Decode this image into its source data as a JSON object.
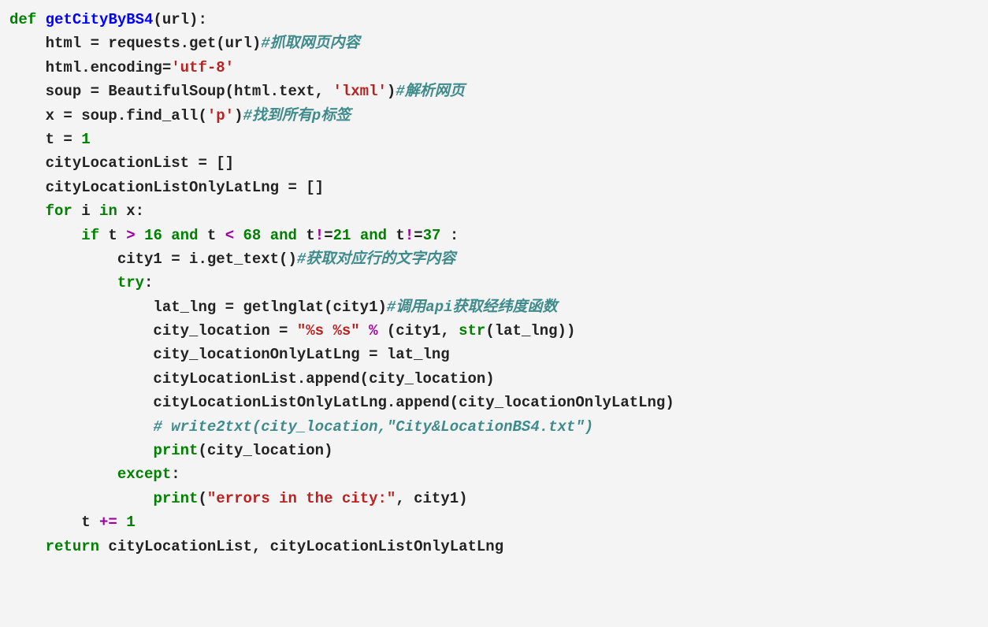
{
  "code": {
    "l1_def": "def",
    "l1_fn": "getCityByBS4",
    "l1_rest": "(url):",
    "l2_a": "    html = requests.get(url)",
    "l2_c": "#抓取网页内容",
    "l3_a": "    html.encoding=",
    "l3_s": "'utf-8'",
    "l4_a": "    soup = BeautifulSoup(html.text, ",
    "l4_s": "'lxml'",
    "l4_b": ")",
    "l4_c": "#解析网页",
    "l5_a": "    x = soup.find_all(",
    "l5_s": "'p'",
    "l5_b": ")",
    "l5_c": "#找到所有p标签",
    "l6_a": "    t = ",
    "l6_n": "1",
    "l7": "    cityLocationList = []",
    "l8": "    cityLocationListOnlyLatLng = []",
    "l9_for": "for",
    "l9_a": " i ",
    "l9_in": "in",
    "l9_b": " x:",
    "l10_if": "if",
    "l10_a": " t ",
    "l10_gt": ">",
    "l10_sp": " ",
    "l10_n1": "16",
    "l10_and1": "and",
    "l10_b": " t ",
    "l10_lt": "<",
    "l10_n2": "68",
    "l10_and2": "and",
    "l10_c": " t",
    "l10_ne1": "!",
    "l10_eq1": "=",
    "l10_n3": "21",
    "l10_and3": "and",
    "l10_d": " t",
    "l10_ne2": "!",
    "l10_eq2": "=",
    "l10_n4": "37",
    "l10_e": " :",
    "l11_a": "            city1 = i.get_text()",
    "l11_c": "#获取对应行的文字内容",
    "l12_try": "try",
    "l12_b": ":",
    "l13_a": "                lat_lng = getlnglat(city1)",
    "l13_c": "#调用api获取经纬度函数",
    "l14_a": "                city_location = ",
    "l14_s": "\"%s %s\"",
    "l14_b": " ",
    "l14_op": "%",
    "l14_c": " (city1, ",
    "l14_str": "str",
    "l14_d": "(lat_lng))",
    "l15": "                city_locationOnlyLatLng = lat_lng",
    "l16": "                cityLocationList.append(city_location)",
    "l17": "                cityLocationListOnlyLatLng.append(city_locationOnlyLatLng)",
    "l18_c": "# write2txt(city_location,\"City&LocationBS4.txt\")",
    "l19_print": "print",
    "l19_b": "(city_location)",
    "l20_except": "except",
    "l20_b": ":",
    "l21_print": "print",
    "l21_a": "(",
    "l21_s": "\"errors in the city:\"",
    "l21_b": ", city1)",
    "l22_a": "        t ",
    "l22_op": "+=",
    "l22_sp": " ",
    "l22_n": "1",
    "l23_ret": "return",
    "l23_a": " cityLocationList, cityLocationListOnlyLatLng"
  }
}
